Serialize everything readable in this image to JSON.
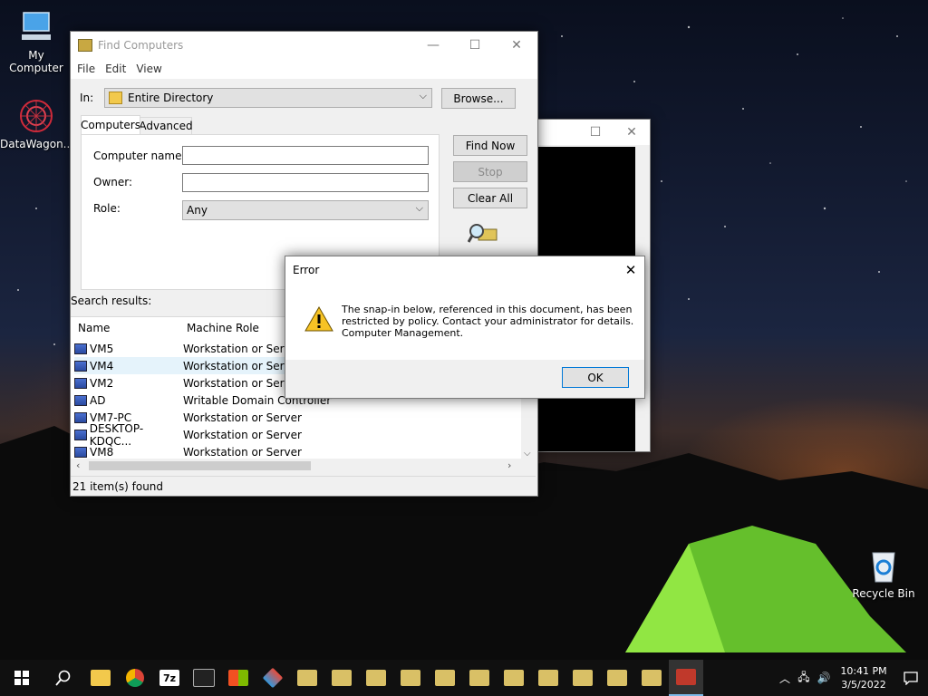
{
  "desktop": {
    "icons": [
      {
        "label": "My Computer",
        "icon": "monitor-icon"
      },
      {
        "label": "DataWagon...",
        "icon": "datawagon-icon"
      },
      {
        "label": "Recycle Bin",
        "icon": "recycle-bin-icon"
      }
    ]
  },
  "find_window": {
    "title": "Find Computers",
    "menu": [
      "File",
      "Edit",
      "View"
    ],
    "in_label": "In:",
    "in_value": "Entire Directory",
    "browse_label": "Browse...",
    "tabs": [
      "Computers",
      "Advanced"
    ],
    "fields": {
      "computer_name_label": "Computer name:",
      "computer_name_value": "",
      "owner_label": "Owner:",
      "owner_value": "",
      "role_label": "Role:",
      "role_value": "Any"
    },
    "buttons": {
      "find_now": "Find Now",
      "stop": "Stop",
      "clear_all": "Clear All"
    },
    "search_results_label": "Search results:",
    "columns": [
      "Name",
      "Machine Role"
    ],
    "rows": [
      {
        "name": "VM5",
        "role": "Workstation or Server"
      },
      {
        "name": "VM4",
        "role": "Workstation or Server"
      },
      {
        "name": "VM2",
        "role": "Workstation or Server"
      },
      {
        "name": "AD",
        "role": "Writable Domain Controller"
      },
      {
        "name": "VM7-PC",
        "role": "Workstation or Server"
      },
      {
        "name": "DESKTOP-KDQC...",
        "role": "Workstation or Server"
      },
      {
        "name": "VM8",
        "role": "Workstation or Server"
      }
    ],
    "status": "21 item(s) found"
  },
  "error_dialog": {
    "title": "Error",
    "message_lines": [
      "The snap-in below, referenced in this document, has been",
      "restricted by policy. Contact your administrator for details.",
      "Computer Management."
    ],
    "ok_label": "OK"
  },
  "taskbar": {
    "time": "10:41 PM",
    "date": "3/5/2022"
  }
}
